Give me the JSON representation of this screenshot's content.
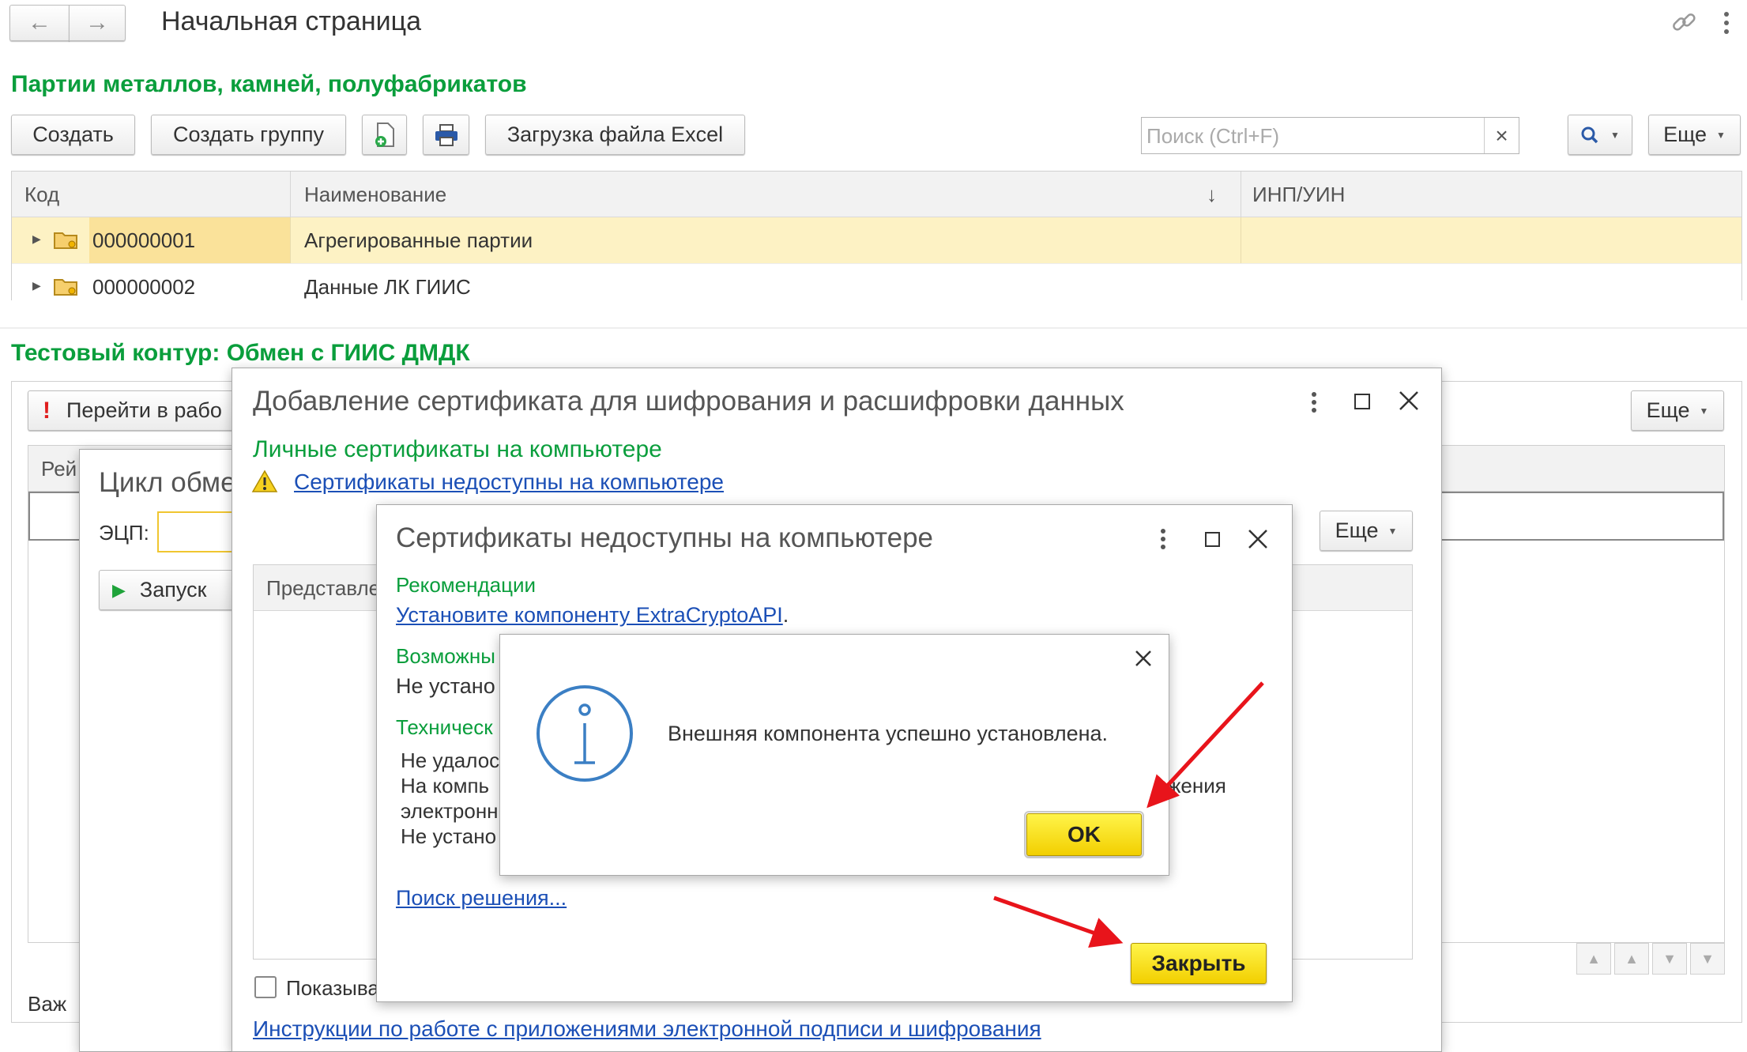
{
  "home": {
    "title": "Начальная страница"
  },
  "section1": {
    "title": "Партии металлов, камней, полуфабрикатов",
    "buttons": {
      "create": "Создать",
      "create_group": "Создать группу",
      "excel": "Загрузка файла Excel",
      "more": "Еще"
    },
    "search_placeholder": "Поиск (Ctrl+F)",
    "clear": "×",
    "columns": [
      "Код",
      "Наименование",
      "↓",
      "ИНП/УИН"
    ],
    "rows": [
      {
        "code": "000000001",
        "name": "Агрегированные партии",
        "inp": ""
      },
      {
        "code": "000000002",
        "name": "Данные ЛК ГИИС",
        "inp": ""
      }
    ]
  },
  "section2": {
    "title": "Тестовый контур: Обмен с ГИИС ДМДК",
    "goto_button": "Перейти в рабо",
    "more": "Еще",
    "col_partial": "Рей",
    "bottom_partial": "Важ"
  },
  "cycle": {
    "title": "Цикл обме",
    "ecp_label": "ЭЦП:",
    "run_button": "Запуск"
  },
  "cert_dialog": {
    "title": "Добавление сертификата для шифрования и расшифровки данных",
    "section": "Личные сертификаты на компьютере",
    "warning_link": "Сертификаты недоступны на компьютере",
    "more": "Еще",
    "col_partial": "Представле",
    "show_partial": "Показыва",
    "instructions_link": "Инструкции по работе с приложениями электронной подписи и шифрования"
  },
  "unavail_dialog": {
    "title": "Сертификаты недоступны на компьютере",
    "recommendations": "Рекомендации",
    "install_link": "Установите компоненту ExtraCryptoAPI",
    "period": ".",
    "possible_partial": "Возможны",
    "not_installed_partial": "Не устано",
    "technical_partial": "Техническ",
    "tech_lines": [
      "Не удалос",
      "На компь",
      "электронн",
      "Не устано"
    ],
    "tech_line_right": "жения",
    "search_link": "Поиск решения...",
    "close_button": "Закрыть"
  },
  "info_dialog": {
    "message": "Внешняя компонента успешно установлена.",
    "ok_button": "OK"
  },
  "colors": {
    "accent_green": "#0a9e3c",
    "link_blue": "#1b4fb6",
    "selected_row": "#fdf2c4",
    "yellow_button": "#f6d800",
    "arrow_red": "#e8141b"
  }
}
